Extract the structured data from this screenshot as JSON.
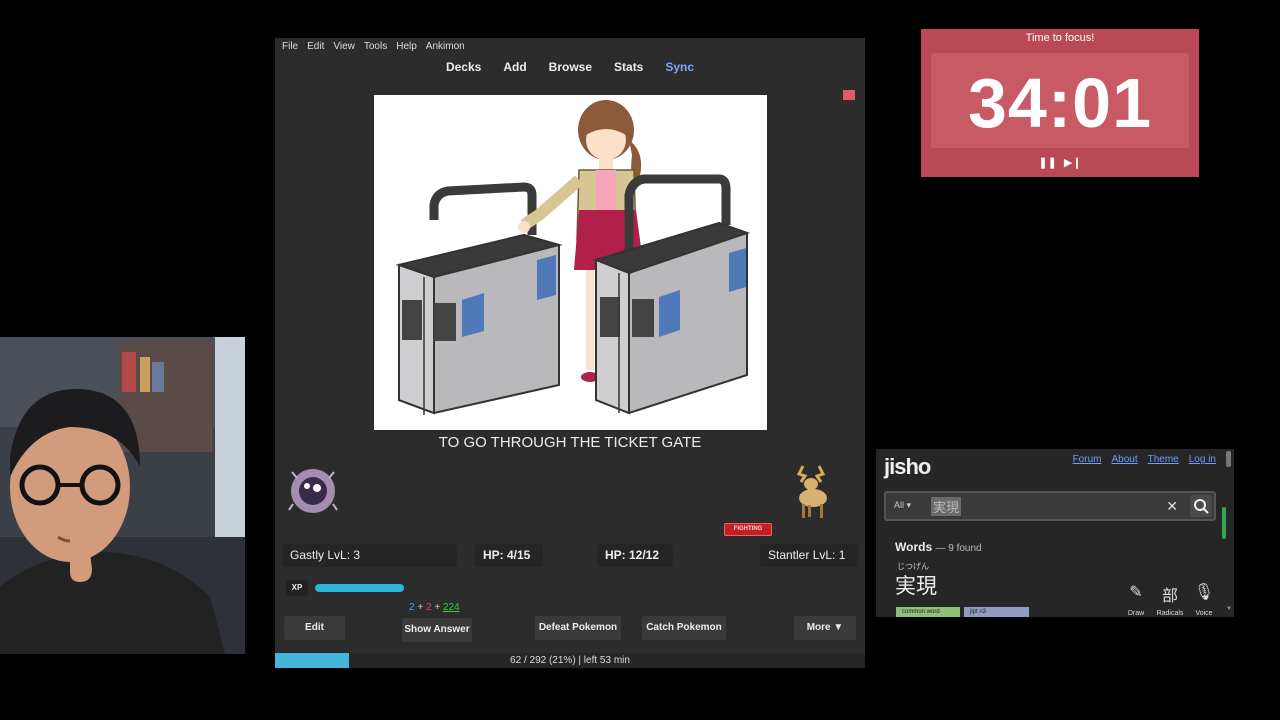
{
  "anki": {
    "menu": [
      "File",
      "Edit",
      "View",
      "Tools",
      "Help",
      "Ankimon"
    ],
    "toolbar": {
      "decks": "Decks",
      "add": "Add",
      "browse": "Browse",
      "stats": "Stats",
      "sync": "Sync"
    },
    "card_answer": "TO GO THROUGH THE TICKET GATE",
    "battle": {
      "player_pokemon": "Gastly LvL: 3",
      "player_hp": "HP: 4/15",
      "enemy_hp": "HP: 12/12",
      "enemy_pokemon": "Stantler LvL: 1",
      "enemy_type_badge": "FIGHTING",
      "xp_label": "XP",
      "xp_fraction": 0.3
    },
    "counts": {
      "new": "2",
      "plus1": "+",
      "learn": "2",
      "plus2": "+",
      "review": "224"
    },
    "buttons": {
      "edit": "Edit",
      "show_answer": "Show Answer",
      "defeat": "Defeat Pokemon",
      "catch": "Catch Pokemon",
      "more": "More ▼"
    },
    "progress": {
      "text": "62 / 292 (21%) | left 53 min",
      "fraction": 0.21
    },
    "flag_color": "#e05a6a"
  },
  "timer": {
    "title": "Time to focus!",
    "time": "34:01",
    "pause_icon": "pause-icon",
    "skip_icon": "skip-icon"
  },
  "jisho": {
    "logo": "jisho",
    "nav": [
      "Forum",
      "About",
      "Theme",
      "Log in"
    ],
    "search": {
      "scope": "All ▾",
      "value": "実現"
    },
    "results": {
      "heading": "Words",
      "count": "— 9 found",
      "furigana": "じつげん",
      "word": "実現",
      "tags": [
        "common word",
        "jlpt n3"
      ]
    },
    "tools": {
      "draw": "Draw",
      "radicals": "Radicals",
      "radicals_glyph": "部",
      "voice": "Voice"
    }
  }
}
